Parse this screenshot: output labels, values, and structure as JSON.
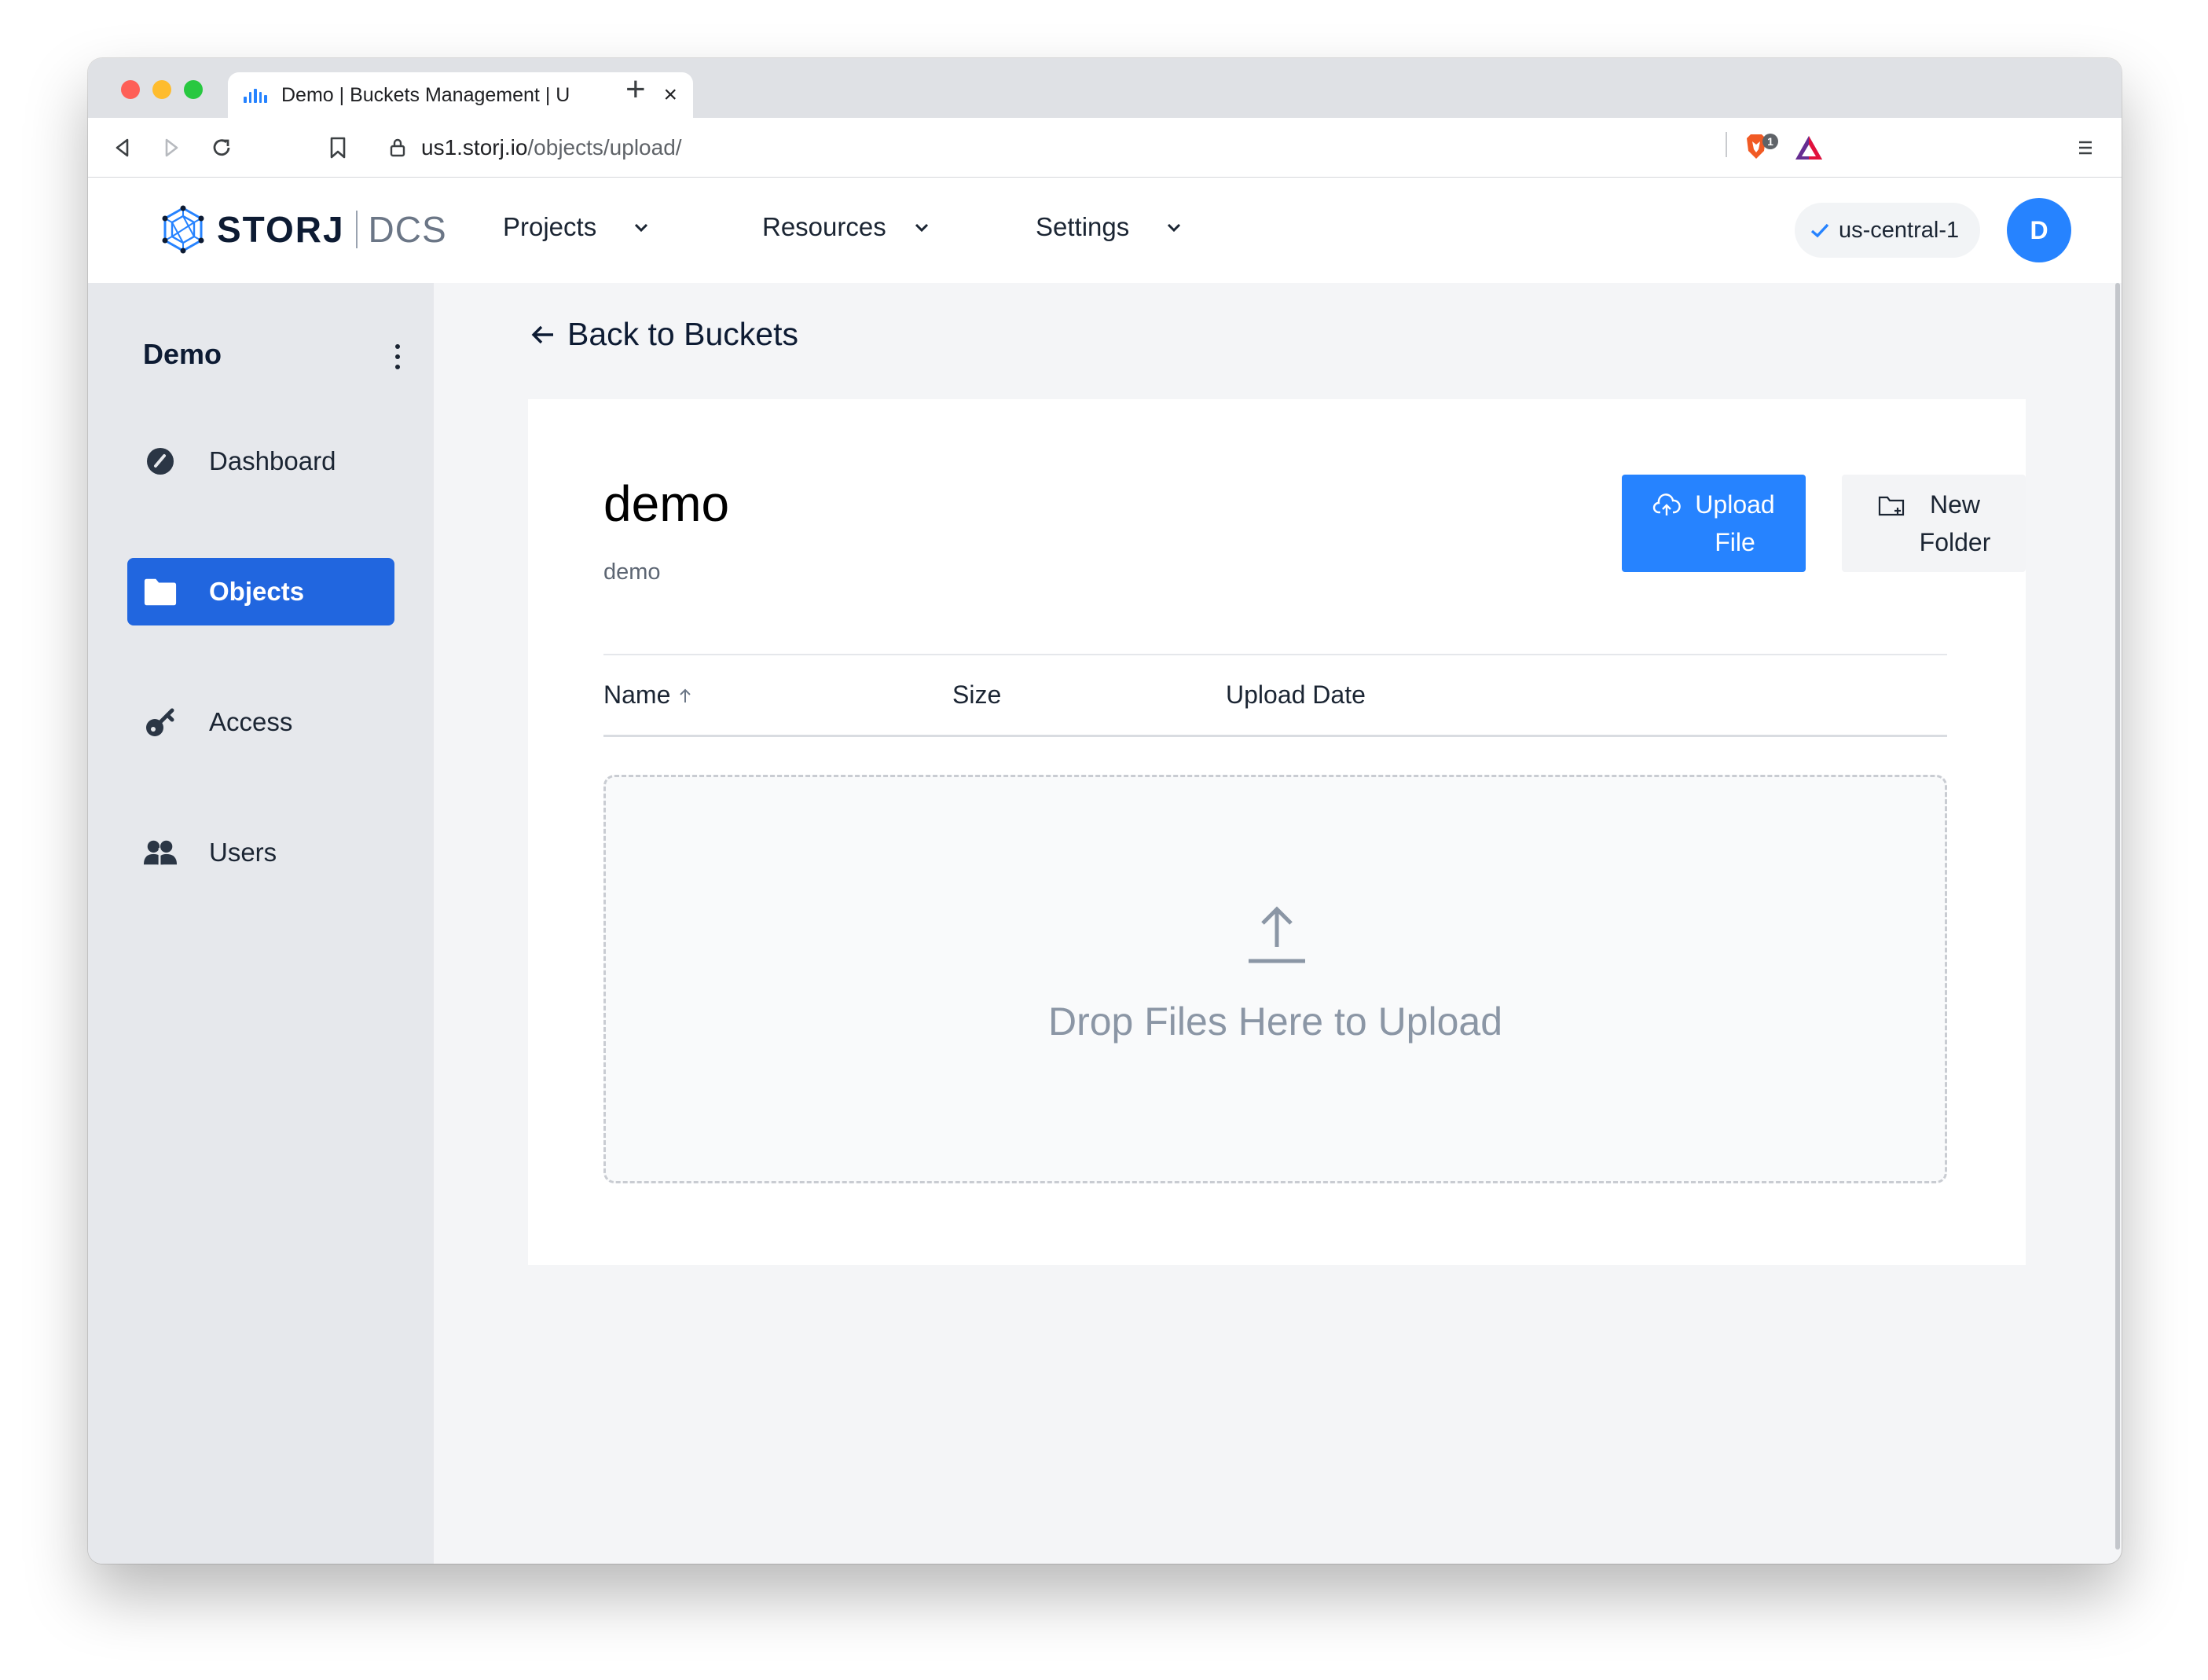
{
  "browser": {
    "tab_title": "Demo | Buckets Management | U",
    "url_host": "us1.storj.io",
    "url_path": "/objects/upload/",
    "icons": [
      "back-icon",
      "forward-icon",
      "reload-icon",
      "bookmark-icon",
      "lock-icon",
      "brave-shield-icon",
      "brave-rewards-icon",
      "menu-icon"
    ],
    "shield_badge": "1"
  },
  "header": {
    "logo_text": "STORJ",
    "logo_product": "DCS",
    "nav": [
      {
        "label": "Projects"
      },
      {
        "label": "Resources"
      },
      {
        "label": "Settings"
      }
    ],
    "region": "us-central-1",
    "avatar_initial": "D"
  },
  "sidebar": {
    "project_name": "Demo",
    "items": [
      {
        "label": "Dashboard",
        "icon": "dashboard-icon",
        "active": false
      },
      {
        "label": "Objects",
        "icon": "folder-icon",
        "active": true
      },
      {
        "label": "Access",
        "icon": "key-icon",
        "active": false
      },
      {
        "label": "Users",
        "icon": "users-icon",
        "active": false
      }
    ]
  },
  "main": {
    "back_label": "Back to Buckets",
    "bucket_title": "demo",
    "bucket_subtitle": "demo",
    "upload_button": {
      "line1": "Upload",
      "line2": "File"
    },
    "new_folder_button": {
      "line1": "New",
      "line2": "Folder"
    },
    "columns": [
      "Name",
      "Size",
      "Upload Date"
    ],
    "sort": {
      "column": "Name",
      "direction": "ascending"
    },
    "dropzone_text": "Drop Files Here to Upload"
  },
  "colors": {
    "accent": "#2683ff",
    "sidebar_active": "#2166df",
    "sidebar_bg": "#e6e8ec"
  }
}
